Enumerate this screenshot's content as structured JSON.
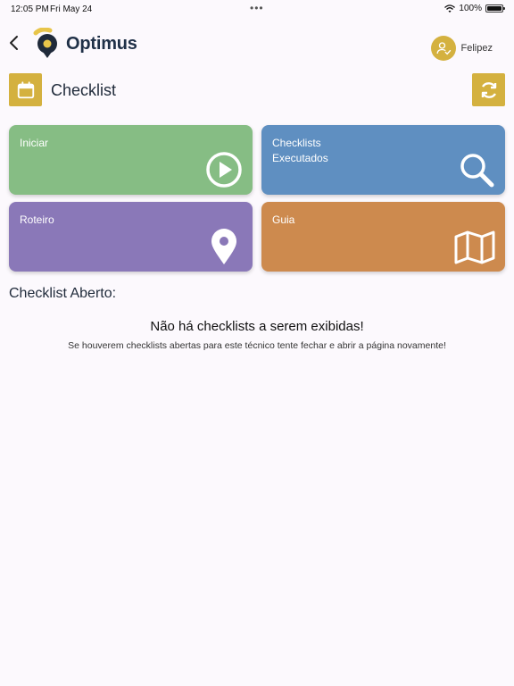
{
  "status": {
    "time": "12:05 PM",
    "date": "Fri May 24",
    "battery": "100%",
    "battery_level": 1.0
  },
  "header": {
    "app_name": "Optimus",
    "user_name": "Felipez"
  },
  "page": {
    "title": "Checklist"
  },
  "cards": [
    {
      "label_line1": "Iniciar",
      "label_line2": "",
      "icon": "play-circle-icon",
      "color": "#86bd84"
    },
    {
      "label_line1": "Checklists",
      "label_line2": "Executados",
      "icon": "search-icon",
      "color": "#5f8fc1"
    },
    {
      "label_line1": "Roteiro",
      "label_line2": "",
      "icon": "map-pin-icon",
      "color": "#8a78b8"
    },
    {
      "label_line1": "Guia",
      "label_line2": "",
      "icon": "map-icon",
      "color": "#cd8a4e"
    }
  ],
  "open_section": {
    "title": "Checklist Aberto:",
    "empty_title": "Não há checklists a serem exibidas!",
    "empty_message": "Se houverem checklists abertas para este técnico tente fechar e abrir a página novamente!"
  },
  "colors": {
    "accent": "#d4b13f",
    "background": "#fcf9fd"
  }
}
